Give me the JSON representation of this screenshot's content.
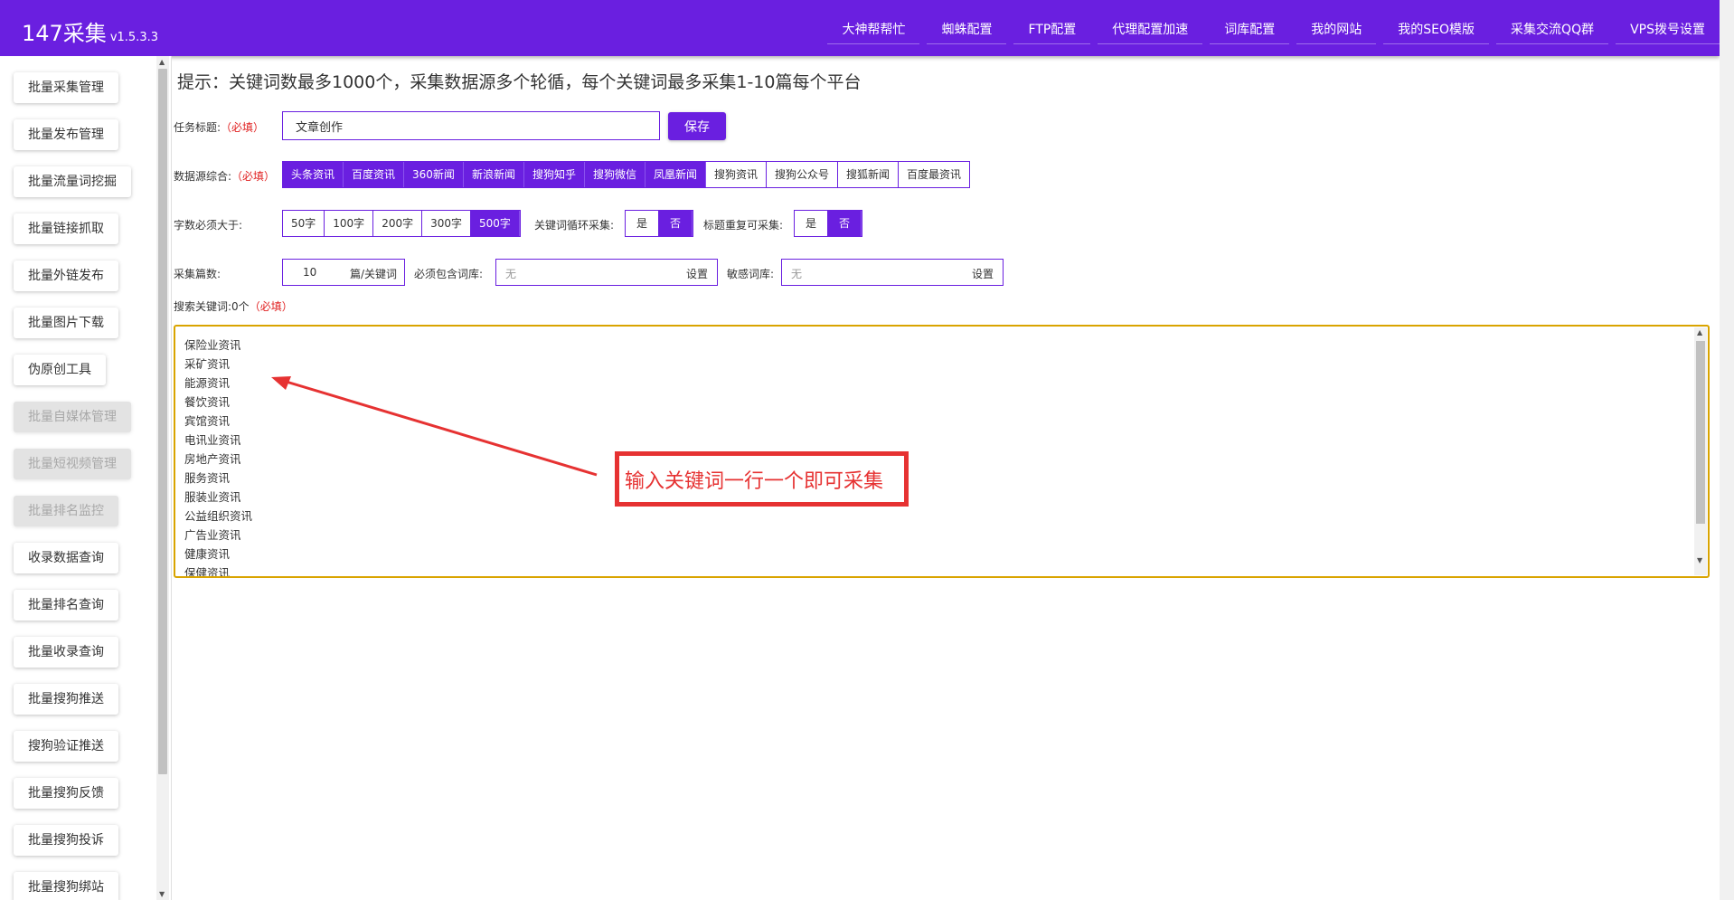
{
  "app": {
    "title": "147采集",
    "version": "v1.5.3.3"
  },
  "nav": [
    "大神帮帮忙",
    "蜘蛛配置",
    "FTP配置",
    "代理配置加速",
    "词库配置",
    "我的网站",
    "我的SEO模版",
    "采集交流QQ群",
    "VPS拨号设置"
  ],
  "sidebar": {
    "items": [
      {
        "label": "批量采集管理",
        "state": "active"
      },
      {
        "label": "批量发布管理",
        "state": "normal"
      },
      {
        "label": "批量流量词挖掘",
        "state": "normal"
      },
      {
        "label": "批量链接抓取",
        "state": "normal"
      },
      {
        "label": "批量外链发布",
        "state": "normal"
      },
      {
        "label": "批量图片下载",
        "state": "normal"
      },
      {
        "label": "伪原创工具",
        "state": "normal"
      },
      {
        "label": "批量自媒体管理",
        "state": "disabled"
      },
      {
        "label": "批量短视频管理",
        "state": "disabled"
      },
      {
        "label": "批量排名监控",
        "state": "disabled"
      },
      {
        "label": "收录数据查询",
        "state": "normal"
      },
      {
        "label": "批量排名查询",
        "state": "normal"
      },
      {
        "label": "批量收录查询",
        "state": "normal"
      },
      {
        "label": "批量搜狗推送",
        "state": "normal"
      },
      {
        "label": "搜狗验证推送",
        "state": "normal"
      },
      {
        "label": "批量搜狗反馈",
        "state": "normal"
      },
      {
        "label": "批量搜狗投诉",
        "state": "normal"
      },
      {
        "label": "批量搜狗绑站",
        "state": "normal"
      }
    ]
  },
  "main": {
    "tip": "提示：关键词数最多1000个，采集数据源多个轮循，每个关键词最多采集1-10篇每个平台",
    "required": "（必填）",
    "task": {
      "label": "任务标题:",
      "value": "文章创作",
      "save_label": "保存"
    },
    "sources": {
      "label": "数据源综合:",
      "options": [
        {
          "label": "头条资讯",
          "selected": true
        },
        {
          "label": "百度资讯",
          "selected": true
        },
        {
          "label": "360新闻",
          "selected": true
        },
        {
          "label": "新浪新闻",
          "selected": true
        },
        {
          "label": "搜狗知乎",
          "selected": true
        },
        {
          "label": "搜狗微信",
          "selected": true
        },
        {
          "label": "凤凰新闻",
          "selected": true
        },
        {
          "label": "搜狗资讯",
          "selected": false
        },
        {
          "label": "搜狗公众号",
          "selected": false
        },
        {
          "label": "搜狐新闻",
          "selected": false
        },
        {
          "label": "百度最资讯",
          "selected": false
        }
      ]
    },
    "wordcount": {
      "label": "字数必须大于:",
      "options": [
        {
          "label": "50字",
          "selected": false
        },
        {
          "label": "100字",
          "selected": false
        },
        {
          "label": "200字",
          "selected": false
        },
        {
          "label": "300字",
          "selected": false
        },
        {
          "label": "500字",
          "selected": true
        }
      ]
    },
    "keyword_loop": {
      "label": "关键词循环采集:",
      "options": [
        {
          "label": "是",
          "selected": false
        },
        {
          "label": "否",
          "selected": true
        }
      ]
    },
    "title_repeat": {
      "label": "标题重复可采集:",
      "options": [
        {
          "label": "是",
          "selected": false
        },
        {
          "label": "否",
          "selected": true
        }
      ]
    },
    "count": {
      "label": "采集篇数:",
      "value": "10",
      "unit": "篇/关键词"
    },
    "must_include": {
      "label": "必须包含词库:",
      "placeholder": "无",
      "action": "设置"
    },
    "sensitive": {
      "label": "敏感词库:",
      "placeholder": "无",
      "action": "设置"
    },
    "keywords": {
      "label": "搜索关键词:0个",
      "lines": [
        "保险业资讯",
        "采矿资讯",
        "能源资讯",
        "餐饮资讯",
        "宾馆资讯",
        "电讯业资讯",
        "房地产资讯",
        "服务资讯",
        "服装业资讯",
        "公益组织资讯",
        "广告业资讯",
        "健康资讯",
        "保健资讯"
      ]
    },
    "annotation": "输入关键词一行一个即可采集"
  },
  "colors": {
    "primary": "#6a1fe0",
    "required": "#e02020",
    "annotation": "#e63232",
    "focus_border": "#d9a400"
  }
}
